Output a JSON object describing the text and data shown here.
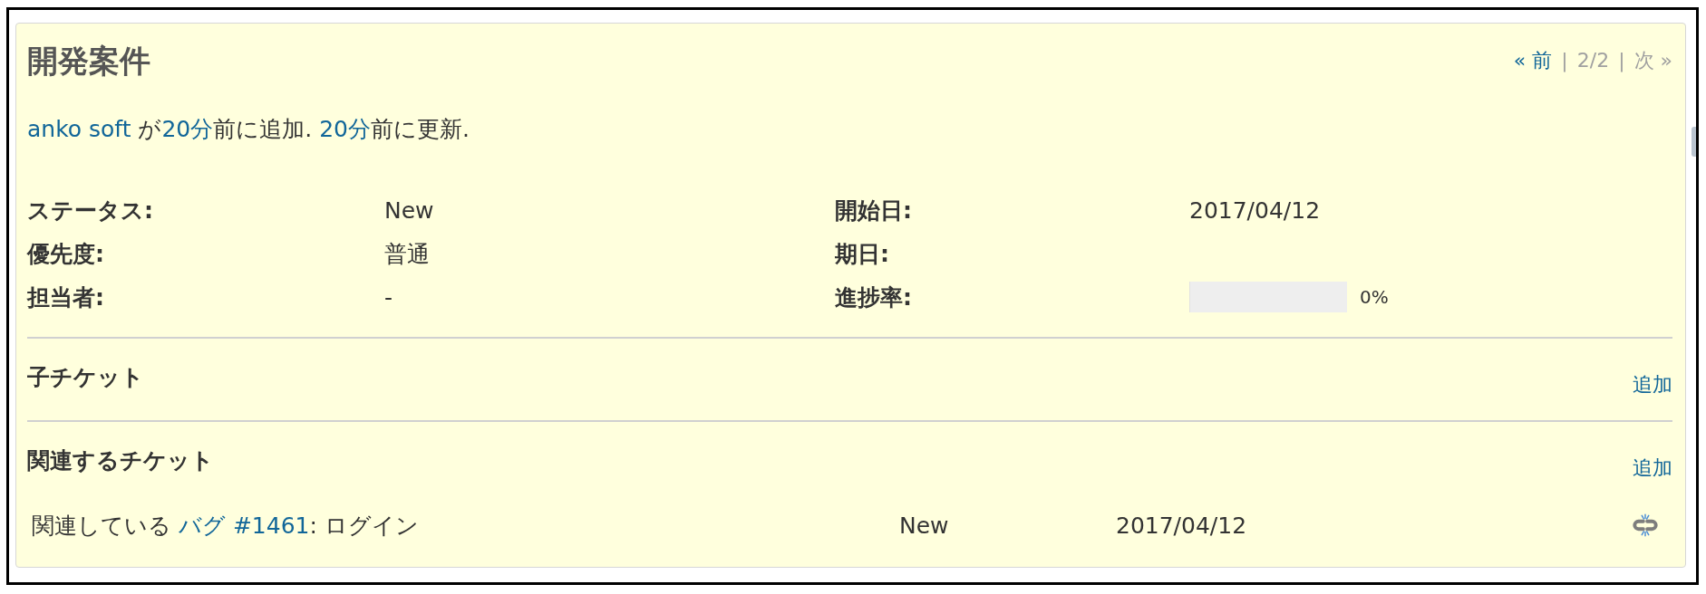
{
  "issue": {
    "title": "開発案件",
    "pager": [
      {
        "kind": "link",
        "label": "« 前",
        "disabled": false
      },
      {
        "kind": "separator",
        "label": "|"
      },
      {
        "kind": "position",
        "label": "2/2"
      },
      {
        "kind": "separator",
        "label": "|"
      },
      {
        "kind": "link",
        "label": "次 »",
        "disabled": true
      }
    ],
    "author_line": [
      {
        "kind": "user",
        "text": "anko soft"
      },
      {
        "kind": "text",
        "text": " が"
      },
      {
        "kind": "time",
        "text": "20分"
      },
      {
        "kind": "text",
        "text": "前に追加. "
      },
      {
        "kind": "time",
        "text": "20分"
      },
      {
        "kind": "text",
        "text": "前に更新."
      }
    ],
    "attributes": {
      "left": [
        {
          "kind": "text",
          "label": "ステータス:",
          "value": "New"
        },
        {
          "kind": "text",
          "label": "優先度:",
          "value": "普通"
        },
        {
          "kind": "text",
          "label": "担当者:",
          "value": "-"
        }
      ],
      "right": [
        {
          "kind": "text",
          "label": "開始日:",
          "value": "2017/04/12"
        },
        {
          "kind": "text",
          "label": "期日:"
        },
        {
          "kind": "progress",
          "label": "進捗率:",
          "level": 0,
          "reading": "0%"
        }
      ]
    },
    "subtasks": {
      "title": "子チケット",
      "add_link": "追加"
    },
    "relations": {
      "title": "関連するチケット",
      "add_link": "追加",
      "rows": [
        {
          "relation": "関連している",
          "issue": "バグ #1461",
          "subject": ": ログイン",
          "status": "New",
          "start_date": "2017/04/12"
        }
      ]
    }
  }
}
